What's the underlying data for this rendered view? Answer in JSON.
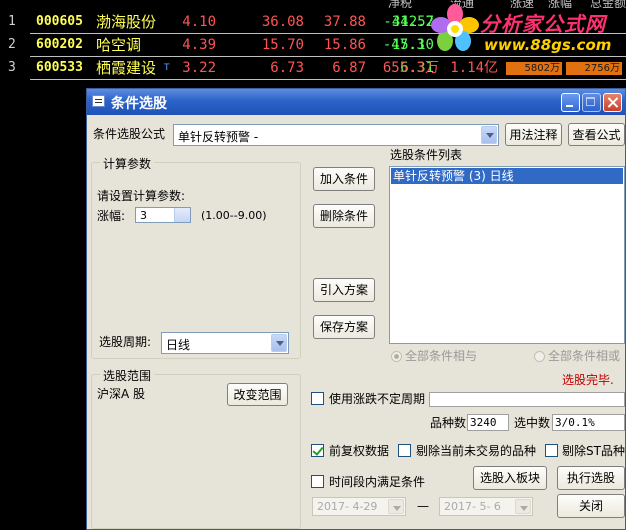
{
  "stocks": {
    "header": [
      "净税",
      "流通",
      "涨速",
      "涨幅",
      "总金额"
    ],
    "rows": [
      {
        "idx": "1",
        "code": "000605",
        "name": "渤海股份",
        "marker": "",
        "v1": "4.10",
        "v2": "36.08",
        "v3": "37.88",
        "v4": "34.52",
        "v5": "-412.7",
        "v6": "",
        "bar1": "",
        "bar2": ""
      },
      {
        "idx": "2",
        "code": "600202",
        "name": "哈空调",
        "marker": "",
        "v1": "4.39",
        "v2": "15.70",
        "v3": "15.86",
        "v4": "15.10",
        "v5": "-47.3",
        "v6": "",
        "bar1": "",
        "bar2": ""
      },
      {
        "idx": "3",
        "code": "600533",
        "name": "栖霞建设",
        "marker": "T",
        "v1": "3.22",
        "v2": "6.73",
        "v3": "6.87",
        "v4": "6.31",
        "v5": "655.3万",
        "v6": "1.14亿",
        "bar1": "5802万",
        "bar2": "2756万"
      }
    ]
  },
  "logo": {
    "title": "分析家公式网",
    "url": "www.88gs.com"
  },
  "dialog": {
    "title": "条件选股",
    "formula_label": "条件选股公式",
    "formula_value": "单针反转预警 -",
    "usage_button": "用法注释",
    "view_button": "查看公式",
    "params_group": "计算参数",
    "params_prompt": "请设置计算参数:",
    "param_name": "涨幅:",
    "param_value": "3",
    "param_range": "(1.00--9.00)",
    "period_label": "选股周期:",
    "period_value": "日线",
    "add_button": "加入条件",
    "delete_button": "删除条件",
    "import_button": "引入方案",
    "save_button": "保存方案",
    "list_label": "选股条件列表",
    "list_items": [
      "单针反转预警 (3) 日线"
    ],
    "radio_and": "全部条件相与",
    "radio_or": "全部条件相或",
    "status": "选股完毕.",
    "scope_group": "选股范围",
    "scope_value": "沪深A 股",
    "change_scope_button": "改变范围",
    "use_period_label": "使用涨跌不定周期",
    "count_label": "品种数",
    "count_value": "3240",
    "selected_label": "选中数",
    "selected_value": "3/0.1%",
    "fq_label": "前复权数据",
    "exclude_label": "剔除当前未交易的品种",
    "exclude_st_label": "剔除ST品种",
    "time_label": "时间段内满足条件",
    "to_block_button": "选股入板块",
    "run_button": "执行选股",
    "close_button": "关闭",
    "date_from": "2017- 4-29",
    "date_to": "2017- 5- 6",
    "date_dash": "—"
  },
  "colors": {
    "accent": "#316ac5",
    "status": "#c00000",
    "up": "#ff5454",
    "down": "#54ff54",
    "stock_name": "#ffff54"
  }
}
